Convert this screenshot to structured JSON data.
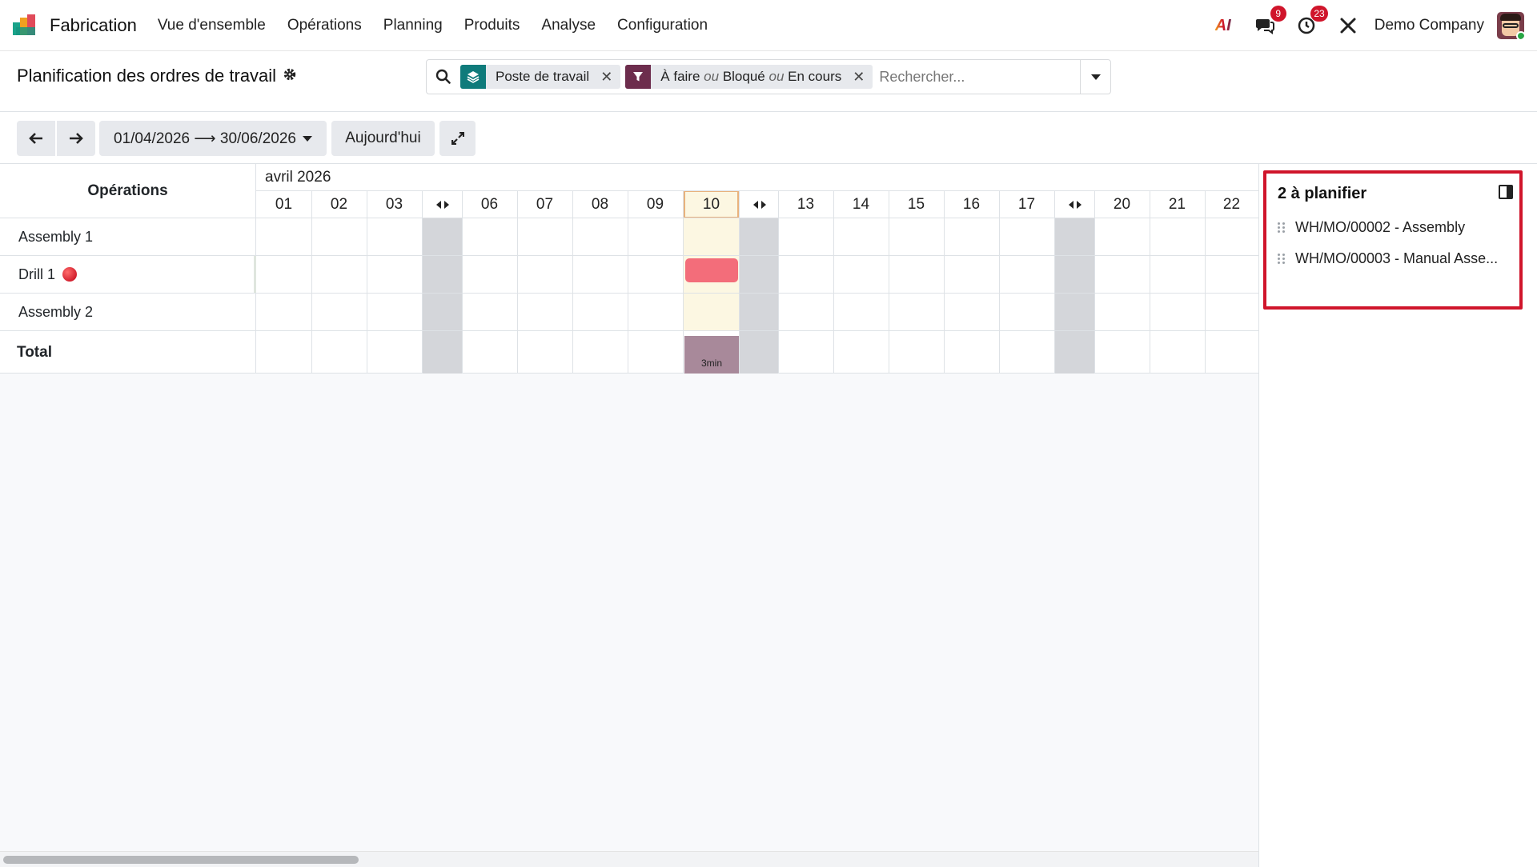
{
  "app": {
    "name": "Fabrication",
    "menu": [
      "Vue d'ensemble",
      "Opérations",
      "Planning",
      "Produits",
      "Analyse",
      "Configuration"
    ],
    "ai_label": "AI",
    "messages_badge": "9",
    "activities_badge": "23",
    "company": "Demo Company"
  },
  "control_panel": {
    "title": "Planification des ordres de travail",
    "facets": [
      {
        "label": "Poste de travail",
        "icon": "layers-icon",
        "color": "#0f7b7b"
      },
      {
        "parts": [
          "À faire",
          "ou",
          "Bloqué",
          "ou",
          "En cours"
        ],
        "icon": "filter-icon",
        "color": "#6d2d4d"
      }
    ],
    "search_placeholder": "Rechercher..."
  },
  "toolbar": {
    "range": "01/04/2026 ⟶ 30/06/2026",
    "today": "Aujourd'hui"
  },
  "gantt": {
    "header": "Opérations",
    "month": "avril 2026",
    "days": [
      "01",
      "02",
      "03",
      "06",
      "07",
      "08",
      "09",
      "10",
      "13",
      "14",
      "15",
      "16",
      "17",
      "20",
      "21",
      "22"
    ],
    "today": "10",
    "rows": [
      "Assembly 1",
      "Drill 1",
      "Assembly 2"
    ],
    "total_label": "Total",
    "total_value": "3min",
    "status_color": "#d0152b",
    "bar_color": "#f36d7a"
  },
  "side_panel": {
    "title": "2 à planifier",
    "items": [
      "WH/MO/00002 - Assembly",
      "WH/MO/00003 - Manual Asse..."
    ]
  }
}
